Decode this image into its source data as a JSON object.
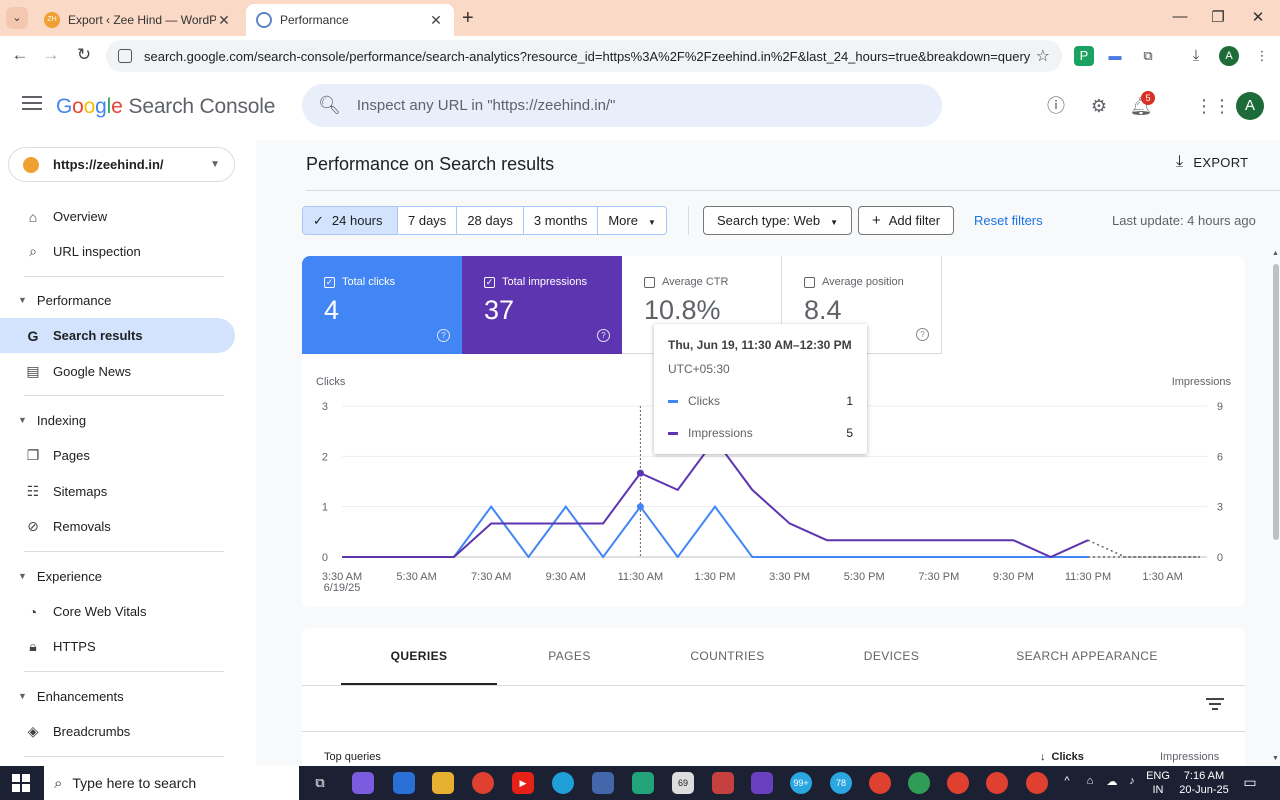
{
  "browser": {
    "tabs": [
      {
        "title": "Export ‹ Zee Hind — WordPress",
        "favicon": "zee-favicon"
      },
      {
        "title": "Performance",
        "favicon": "search-console-favicon"
      }
    ],
    "url": "search.google.com/search-console/performance/search-analytics?resource_id=https%3A%2F%2Fzeehind.in%2F&last_24_hours=true&breakdown=query",
    "profile_initial": "A"
  },
  "header": {
    "logo_letters": [
      "G",
      "o",
      "o",
      "g",
      "l",
      "e"
    ],
    "product": "Search Console",
    "inspect_placeholder": "Inspect any URL in \"https://zeehind.in/\"",
    "notification_count": "5",
    "avatar_initial": "A"
  },
  "sidebar": {
    "property": "https://zeehind.in/",
    "overview": "Overview",
    "url_inspection": "URL inspection",
    "sections": {
      "performance": "Performance",
      "indexing": "Indexing",
      "experience": "Experience",
      "enhancements": "Enhancements"
    },
    "items": {
      "search_results": "Search results",
      "google_news": "Google News",
      "pages": "Pages",
      "sitemaps": "Sitemaps",
      "removals": "Removals",
      "core_web_vitals": "Core Web Vitals",
      "https": "HTTPS",
      "breadcrumbs": "Breadcrumbs"
    }
  },
  "main": {
    "title": "Performance on Search results",
    "export_label": "EXPORT",
    "date_ranges": [
      "24 hours",
      "7 days",
      "28 days",
      "3 months",
      "More"
    ],
    "selected_range": "24 hours",
    "search_type": "Search type: Web",
    "add_filter": "Add filter",
    "reset_filters": "Reset filters",
    "last_update": "Last update: 4 hours ago"
  },
  "metrics": {
    "clicks": {
      "label": "Total clicks",
      "value": "4",
      "checked": true
    },
    "impressions": {
      "label": "Total impressions",
      "value": "37",
      "checked": true
    },
    "ctr": {
      "label": "Average CTR",
      "value": "10.8%",
      "checked": false
    },
    "position": {
      "label": "Average position",
      "value": "8.4",
      "checked": false
    }
  },
  "tooltip": {
    "date": "Thu, Jun 19, 11:30 AM–12:30 PM",
    "timezone": "UTC+05:30",
    "clicks_label": "Clicks",
    "clicks_value": "1",
    "impressions_label": "Impressions",
    "impressions_value": "5"
  },
  "chart_data": {
    "type": "line",
    "left_axis_label": "Clicks",
    "right_axis_label": "Impressions",
    "left_ticks": [
      "0",
      "1",
      "2",
      "3"
    ],
    "right_ticks": [
      "0",
      "3",
      "6",
      "9"
    ],
    "left_ylim": [
      0,
      3
    ],
    "right_ylim": [
      0,
      9
    ],
    "x_tick_labels": [
      "3:30 AM",
      "5:30 AM",
      "7:30 AM",
      "9:30 AM",
      "11:30 AM",
      "1:30 PM",
      "3:30 PM",
      "5:30 PM",
      "7:30 PM",
      "9:30 PM",
      "11:30 PM",
      "1:30 AM"
    ],
    "x_tick_sub": "6/19/25",
    "x": [
      "3:30 AM",
      "4:30 AM",
      "5:30 AM",
      "6:30 AM",
      "7:30 AM",
      "8:30 AM",
      "9:30 AM",
      "10:30 AM",
      "11:30 AM",
      "12:30 PM",
      "1:30 PM",
      "2:30 PM",
      "3:30 PM",
      "4:30 PM",
      "5:30 PM",
      "6:30 PM",
      "7:30 PM",
      "8:30 PM",
      "9:30 PM",
      "10:30 PM",
      "11:30 PM",
      "12:30 AM",
      "1:30 AM",
      "2:30 AM"
    ],
    "series": [
      {
        "name": "Clicks",
        "axis": "left",
        "color": "#4285f4",
        "values": [
          0,
          0,
          0,
          0,
          1,
          0,
          1,
          0,
          1,
          0,
          1,
          0,
          0,
          0,
          0,
          0,
          0,
          0,
          0,
          0,
          0,
          0,
          0,
          0
        ],
        "projected_from_index": 20
      },
      {
        "name": "Impressions",
        "axis": "right",
        "color": "#5e35b1",
        "values": [
          0,
          0,
          0,
          0,
          2,
          2,
          2,
          2,
          5,
          4,
          7,
          4,
          2,
          1,
          1,
          1,
          1,
          1,
          1,
          0,
          1,
          0,
          0,
          0
        ],
        "projected_from_index": 20
      }
    ],
    "hover_index": 8,
    "grid": true
  },
  "report_tabs": [
    "QUERIES",
    "PAGES",
    "COUNTRIES",
    "DEVICES",
    "SEARCH APPEARANCE"
  ],
  "active_report_tab": "QUERIES",
  "table": {
    "label": "Top queries",
    "sort_col": "Clicks",
    "col2": "Impressions"
  },
  "taskbar": {
    "search_placeholder": "Type here to search",
    "badge_69": "69",
    "badge_99": "99+",
    "badge_78": "78",
    "lang": "ENG",
    "region": "IN",
    "time": "7:16 AM",
    "date": "20-Jun-25"
  }
}
